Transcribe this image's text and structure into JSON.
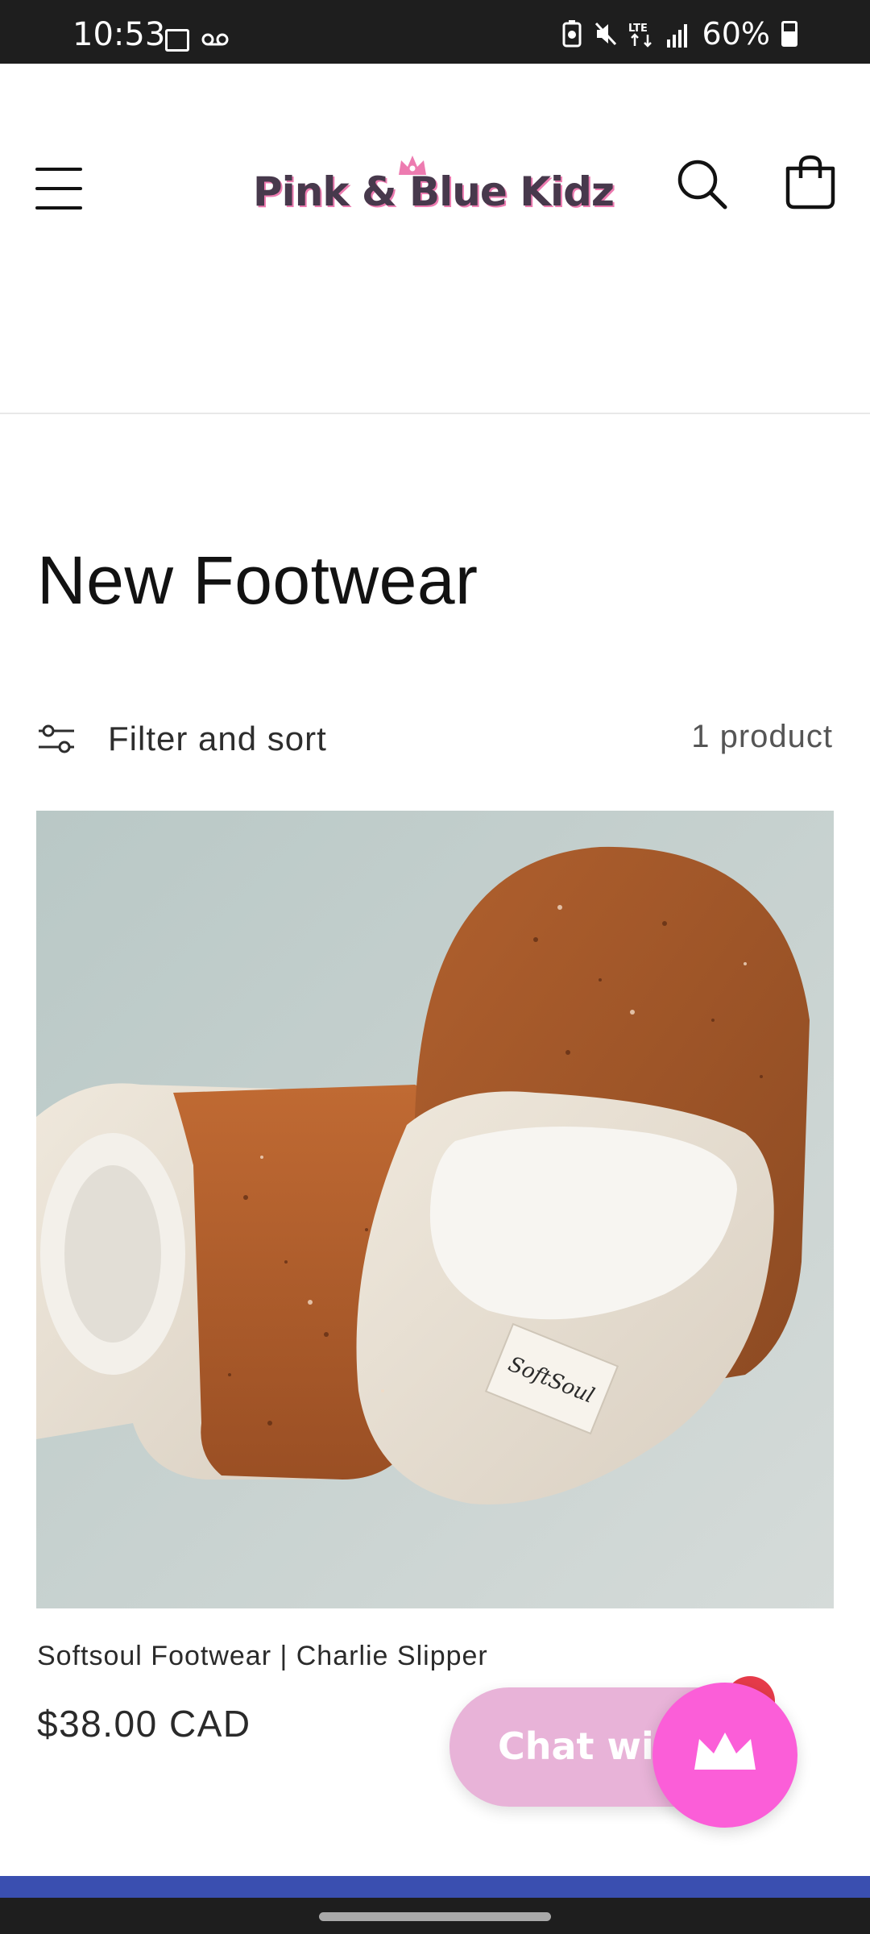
{
  "status_bar": {
    "time": "10:53",
    "battery": "60%",
    "icons": [
      "gallery-icon",
      "voicemail-icon",
      "battery-saver-icon",
      "mute-icon",
      "lte-icon",
      "signal-icon",
      "battery-icon"
    ]
  },
  "header": {
    "logo_text": "Pink & Blue Kidz",
    "menu_icon": "hamburger-menu-icon",
    "search_icon": "search-icon",
    "cart_icon": "cart-icon"
  },
  "collection": {
    "title": "New Footwear",
    "filter_label": "Filter and sort",
    "product_count": "1 product"
  },
  "products": [
    {
      "title": "Softsoul Footwear | Charlie Slipper",
      "price": "$38.00 CAD",
      "label_text": "SoftSoul"
    }
  ],
  "chat": {
    "label": "Chat with",
    "icon": "crown-icon"
  },
  "colors": {
    "logo_text": "#47394c",
    "logo_accent": "#ed7bb0",
    "chat_pill": "#e8b3d8",
    "chat_launcher": "#fb5ed8",
    "chat_badge": "#e63b4a",
    "footer_band": "#3a4fb0"
  }
}
